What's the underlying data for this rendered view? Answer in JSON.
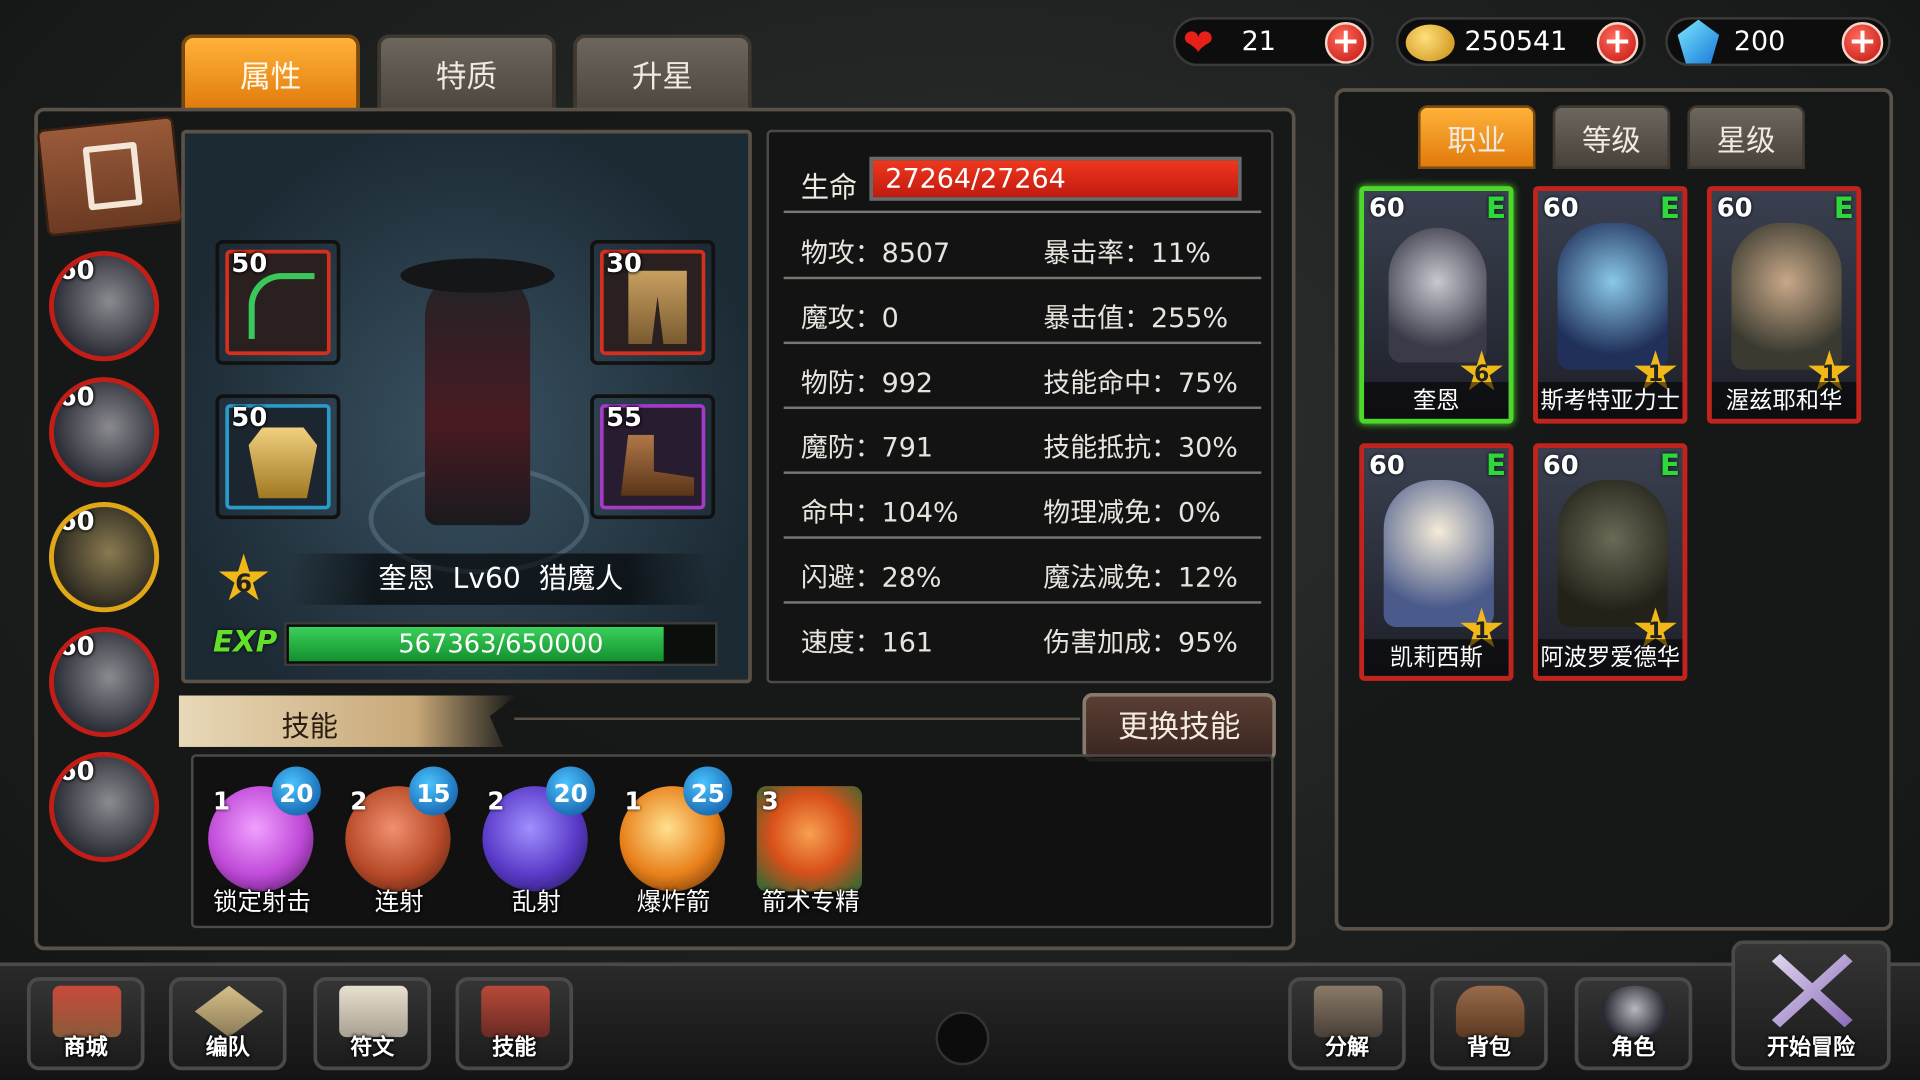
{
  "tabs": [
    "属性",
    "特质",
    "升星"
  ],
  "resources": {
    "hearts": "21",
    "gold": "250541",
    "gems": "200"
  },
  "side_heroes": [
    {
      "level": "60"
    },
    {
      "level": "60"
    },
    {
      "level": "60"
    },
    {
      "level": "60"
    },
    {
      "level": "60"
    }
  ],
  "equipment": [
    {
      "slot": "weapon",
      "level": "50",
      "icon": "bow-icon"
    },
    {
      "slot": "pants",
      "level": "30",
      "icon": "pants-icon"
    },
    {
      "slot": "armor",
      "level": "50",
      "icon": "armor-icon"
    },
    {
      "slot": "boots",
      "level": "55",
      "icon": "boots-icon"
    }
  ],
  "hero": {
    "stars": "6",
    "name_line": "奎恩  Lv60  猎魔人",
    "exp_label": "EXP",
    "exp_text": "567363/650000",
    "exp_fraction": 0.873
  },
  "stats": {
    "hp_label": "生命",
    "hp_value": "27264/27264",
    "rows": [
      {
        "left": "物攻：8507",
        "right": "暴击率：11%"
      },
      {
        "left": "魔攻：0",
        "right": "暴击值：255%"
      },
      {
        "left": "物防：992",
        "right": "技能命中：75%"
      },
      {
        "left": "魔防：791",
        "right": "技能抵抗：30%"
      },
      {
        "left": "命中：104%",
        "right": "物理减免：0%"
      },
      {
        "left": "闪避：28%",
        "right": "魔法减免：12%"
      },
      {
        "left": "速度：161",
        "right": "伤害加成：95%"
      }
    ]
  },
  "skills_title": "技能",
  "change_skill_label": "更换技能",
  "skills": [
    {
      "name": "锁定射击",
      "level": "1",
      "cost": "20",
      "color": "#c04ad8"
    },
    {
      "name": "连射",
      "level": "2",
      "cost": "15",
      "color": "#b84a28"
    },
    {
      "name": "乱射",
      "level": "2",
      "cost": "20",
      "color": "#5a3ac8"
    },
    {
      "name": "爆炸箭",
      "level": "1",
      "cost": "25",
      "color": "#e8801a"
    },
    {
      "name": "箭术专精",
      "level": "3",
      "cost": "",
      "color": "#d8501a"
    }
  ],
  "sort_tabs": [
    "职业",
    "等级",
    "星级"
  ],
  "roster": [
    {
      "name": "奎恩",
      "level": "60",
      "stars": "6",
      "grade": "E"
    },
    {
      "name": "斯考特亚力士",
      "level": "60",
      "stars": "1",
      "grade": "E"
    },
    {
      "name": "渥兹耶和华",
      "level": "60",
      "stars": "1",
      "grade": "E"
    },
    {
      "name": "凯莉西斯",
      "level": "60",
      "stars": "1",
      "grade": "E"
    },
    {
      "name": "阿波罗爱德华",
      "level": "60",
      "stars": "1",
      "grade": "E"
    }
  ],
  "bottom_nav": [
    "商城",
    "编队",
    "符文",
    "技能",
    "分解",
    "背包",
    "角色",
    "开始冒险"
  ],
  "colors": {
    "accent": "#f08c1a",
    "hp_bar": "#e0281a",
    "exp_bar": "#1ea83a",
    "selected": "#4fd82c"
  }
}
